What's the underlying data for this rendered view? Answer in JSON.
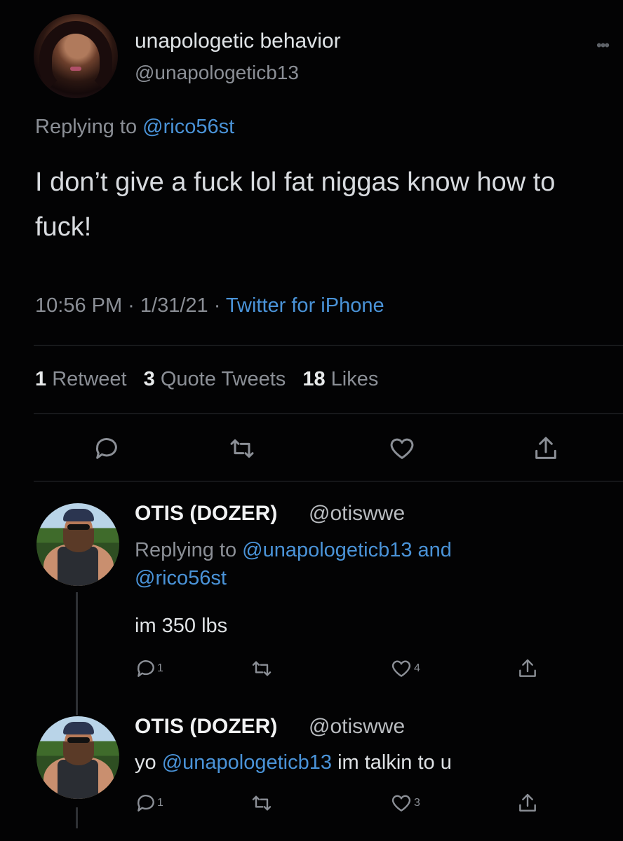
{
  "main_tweet": {
    "display_name": "unapologetic behavior",
    "handle": "@unapologeticb13",
    "replying_prefix": "Replying to",
    "replying_handle": "@rico56st",
    "text": "I don’t give a fuck lol fat niggas know how to fuck!",
    "timestamp": "10:56 PM · 1/31/21 ·",
    "source": "Twitter for iPhone",
    "stats": {
      "retweets_count": "1",
      "retweets_label": "Retweet",
      "quotes_count": "3",
      "quotes_label": "Quote Tweets",
      "likes_count": "18",
      "likes_label": "Likes"
    }
  },
  "replies": [
    {
      "display_name": "OTIS (DOZER)",
      "handle": "@otiswwe",
      "replying_prefix": "Replying to",
      "replying_handle_1": "@unapologeticb13",
      "replying_and": "and",
      "replying_handle_2": "@rico56st",
      "text": "im 350 lbs",
      "reply_count": "1",
      "like_count": "4"
    },
    {
      "display_name": "OTIS (DOZER)",
      "handle": "@otiswwe",
      "text_prefix": "yo",
      "text_mention": "@unapologeticb13",
      "text_suffix": "im talkin to u",
      "reply_count": "1",
      "like_count": "3"
    }
  ],
  "colors": {
    "background": "#030304",
    "link": "#4a93d8",
    "muted": "#8b8f96"
  }
}
